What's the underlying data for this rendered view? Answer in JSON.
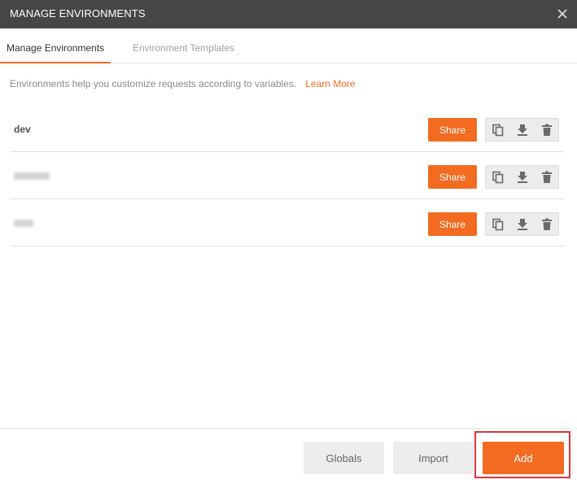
{
  "dialog": {
    "title": "MANAGE ENVIRONMENTS",
    "close_icon": "close-icon"
  },
  "tabs": [
    {
      "label": "Manage Environments",
      "active": true
    },
    {
      "label": "Environment Templates",
      "active": false
    }
  ],
  "description": {
    "text": "Environments help you customize requests according to variables.",
    "link": "Learn More"
  },
  "environments": [
    {
      "name": "dev",
      "obscured": false,
      "share_label": "Share"
    },
    {
      "name": "",
      "obscured": true,
      "share_label": "Share"
    },
    {
      "name": "",
      "obscured": true,
      "share_label": "Share"
    }
  ],
  "row_actions": {
    "icons": [
      "duplicate-icon",
      "download-icon",
      "trash-icon"
    ]
  },
  "footer": {
    "globals_label": "Globals",
    "import_label": "Import",
    "add_label": "Add"
  },
  "colors": {
    "header_bg": "#464646",
    "accent": "#f26b21",
    "highlight": "#e0353b"
  }
}
